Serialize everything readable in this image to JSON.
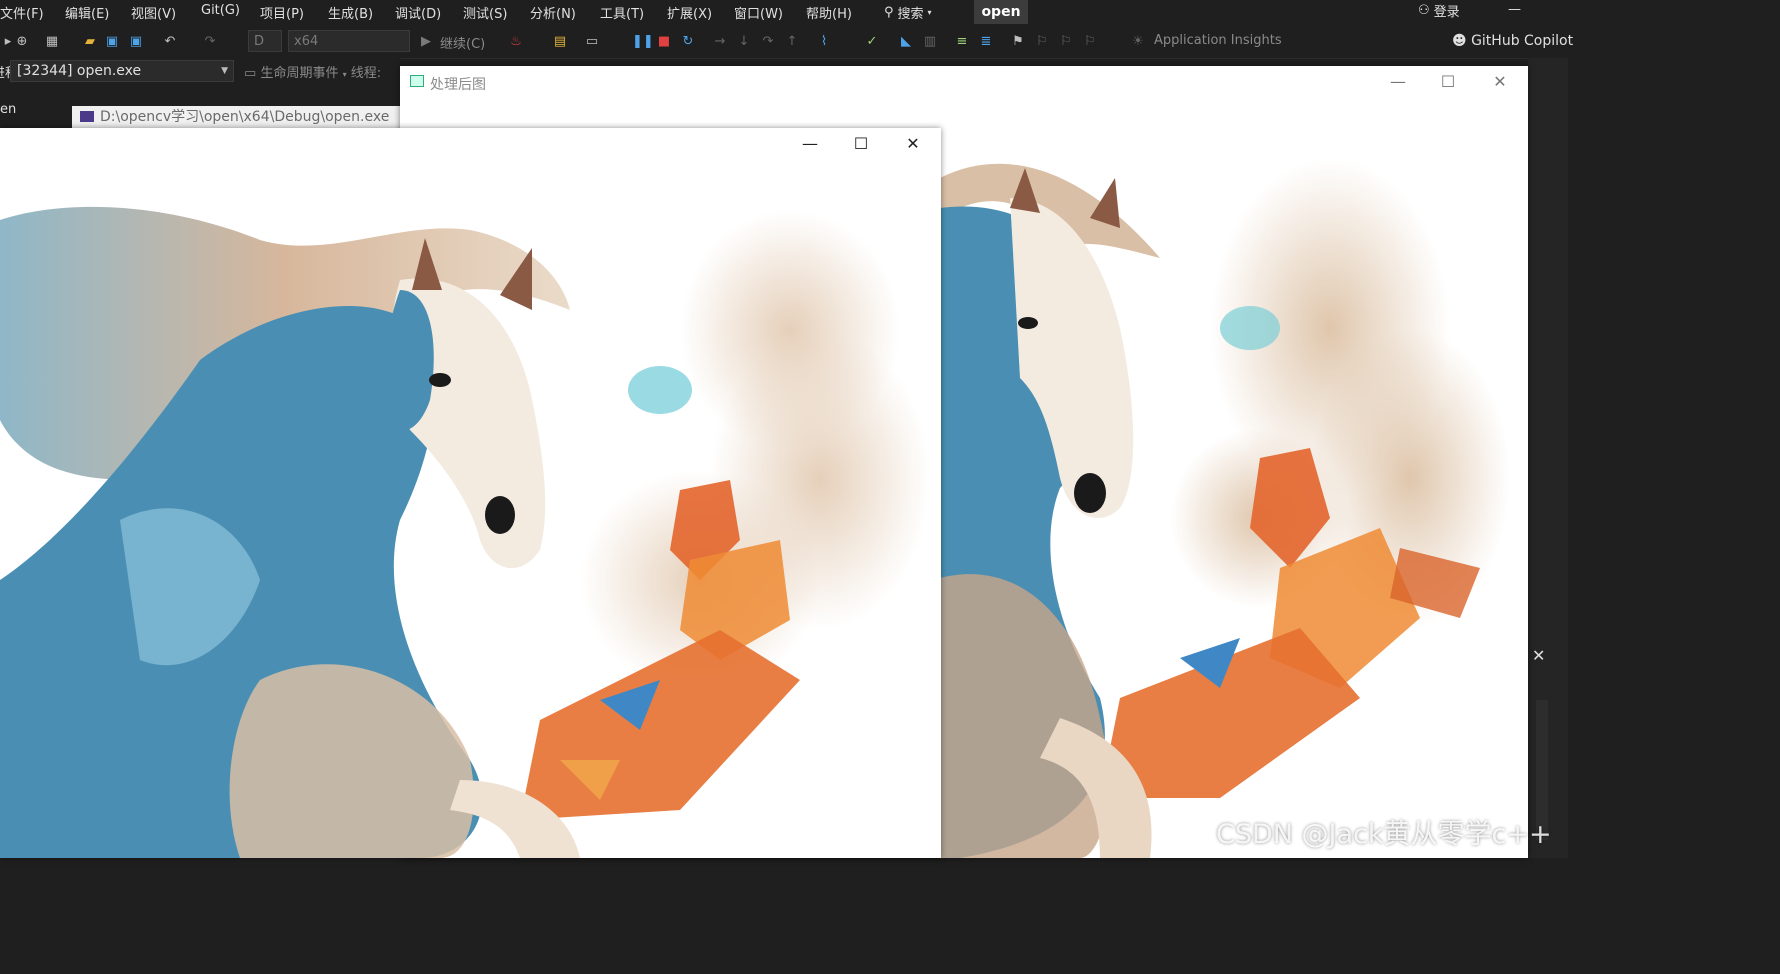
{
  "menubar": {
    "items": [
      "文件(F)",
      "编辑(E)",
      "视图(V)",
      "Git(G)",
      "项目(P)",
      "生成(B)",
      "调试(D)",
      "测试(S)",
      "分析(N)",
      "工具(T)",
      "扩展(X)",
      "窗口(W)",
      "帮助(H)"
    ],
    "search_label": "搜索",
    "solution_badge": "open",
    "login_label": "登录"
  },
  "toolbar": {
    "config_dropdown": "D",
    "platform_dropdown": "x64",
    "continue_label": "继续(C)",
    "insights_label": "Application Insights",
    "copilot_label": "GitHub Copilot"
  },
  "process": {
    "prefix": "进程:",
    "selected": "[32344] open.exe",
    "lifecycle_label": "生命周期事件",
    "thread_label": "线程:"
  },
  "left_panel": {
    "label": "en"
  },
  "console_tab": {
    "path": "D:\\opencv学习\\open\\x64\\Debug\\open.exe"
  },
  "window_processed": {
    "title": "处理后图"
  },
  "window_original": {
    "title": ""
  },
  "watermark": "CSDN @Jack黄从零学c++",
  "colors": {
    "vs_bg": "#1f1f1f",
    "horse_blue": "#4a8fb3",
    "splash_orange": "#e8692a",
    "mane_beige": "#d9bfa5"
  }
}
